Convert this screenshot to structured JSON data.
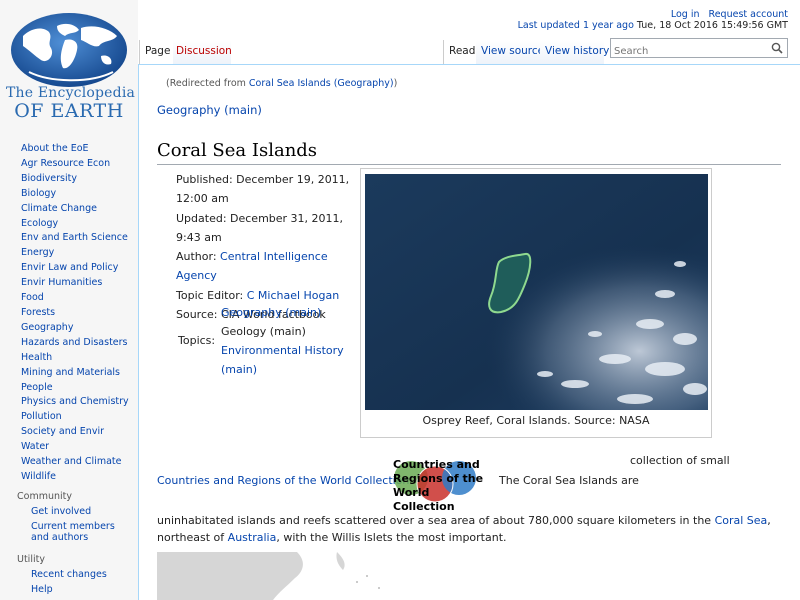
{
  "logo": {
    "line1": "The Encyclopedia",
    "line2": "OF EARTH"
  },
  "sidebar": {
    "nav": [
      "About the EoE",
      "Agr Resource Econ",
      "Biodiversity",
      "Biology",
      "Climate Change",
      "Ecology",
      "Env and Earth Science",
      "Energy",
      "Envir Law and Policy",
      "Envir Humanities",
      "Food",
      "Forests",
      "Geography",
      "Hazards and Disasters",
      "Health",
      "Mining and Materials",
      "People",
      "Physics and Chemistry",
      "Pollution",
      "Society and Envir",
      "Water",
      "Weather and Climate",
      "Wildlife"
    ],
    "community": {
      "heading": "Community",
      "items": [
        "Get involved",
        "Current members and authors"
      ]
    },
    "utility": {
      "heading": "Utility",
      "items": [
        "Recent changes",
        "Help"
      ]
    }
  },
  "header": {
    "login": "Log in",
    "request_account": "Request account",
    "last_updated_link": "Last updated 1 year ago",
    "last_updated_time": "Tue, 18 Oct 2016 15:49:56 GMT"
  },
  "tabs": {
    "page": "Page",
    "discussion": "Discussion",
    "read": "Read",
    "view_source": "View source",
    "view_history": "View history"
  },
  "search": {
    "placeholder": "Search"
  },
  "content": {
    "redirect_prefix": "(Redirected from ",
    "redirect_link": "Coral Sea Islands (Geography)",
    "redirect_suffix": ")",
    "parent_link": "Geography (main)",
    "title": "Coral Sea Islands",
    "published": "Published: December 19, 2011, 12:00 am",
    "updated": "Updated: December 31, 2011, 9:43 am",
    "author_label": "Author: ",
    "author": "Central Intelligence Agency",
    "editor_label": "Topic Editor: ",
    "editor": "C Michael Hogan",
    "source": "Source: CIA World factbook",
    "topics_label": "Topics:",
    "topics": {
      "t1": "Geography (main)",
      "t2": "Geology (main)",
      "t3": "Environmental History (main)"
    },
    "image_caption": "Osprey Reef, Coral Islands. Source: NASA",
    "collection_link": "Countries and Regions of the World Collection",
    "collection_badge": "Countries and Regions of the World Collection",
    "intro_part1": "collection of small",
    "intro_part2": "The Coral Sea Islands are",
    "body_part1": "uninhabitated islands and reefs scattered over a sea area of about 780,000 square kilometers in the ",
    "coral_sea_link": "Coral Sea",
    "body_part2": ", northeast of ",
    "australia_link": "Australia",
    "body_part3": ", with the Willis Islets the most important."
  },
  "colors": {
    "link": "#0645ad",
    "new_link": "#ba0000",
    "border": "#a7d7f9",
    "sidebar_bg": "#f6f6f6"
  }
}
